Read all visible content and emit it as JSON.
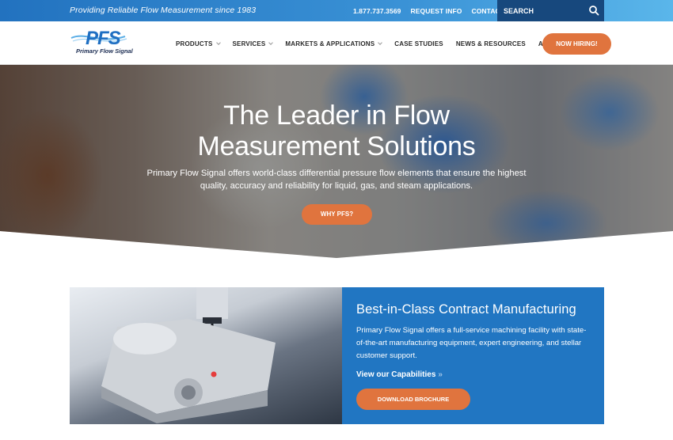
{
  "topbar": {
    "tagline": "Providing Reliable Flow Measurement since 1983",
    "phone": "1.877.737.3569",
    "request_info": "REQUEST INFO",
    "contact": "CONTACT",
    "search_placeholder": "SEARCH",
    "search_icon": "search-icon"
  },
  "brand": {
    "logo_text": "PFS",
    "logo_name": "Primary Flow Signal",
    "colors": {
      "primary": "#2176c2",
      "accent": "#e0743e",
      "dark": "#17487d"
    }
  },
  "nav": {
    "items": [
      {
        "label": "PRODUCTS",
        "has_dropdown": true
      },
      {
        "label": "SERVICES",
        "has_dropdown": true
      },
      {
        "label": "MARKETS & APPLICATIONS",
        "has_dropdown": true
      },
      {
        "label": "CASE STUDIES",
        "has_dropdown": false
      },
      {
        "label": "NEWS & RESOURCES",
        "has_dropdown": false
      },
      {
        "label": "ABOUT",
        "has_dropdown": true
      }
    ],
    "cta": "NOW HIRING!"
  },
  "hero": {
    "title_line1": "The Leader in Flow",
    "title_line2": "Measurement Solutions",
    "description": "Primary Flow Signal offers world-class differential pressure flow elements that ensure the highest quality, accuracy and reliability for liquid, gas, and steam applications.",
    "button": "WHY PFS?"
  },
  "feature": {
    "title": "Best-in-Class Contract Manufacturing",
    "description": "Primary Flow Signal offers a full-service machining facility with state-of-the-art manufacturing equipment, expert engineering, and stellar customer support.",
    "link": "View our Capabilities",
    "link_arrow": "»",
    "button": "DOWNLOAD BROCHURE"
  }
}
